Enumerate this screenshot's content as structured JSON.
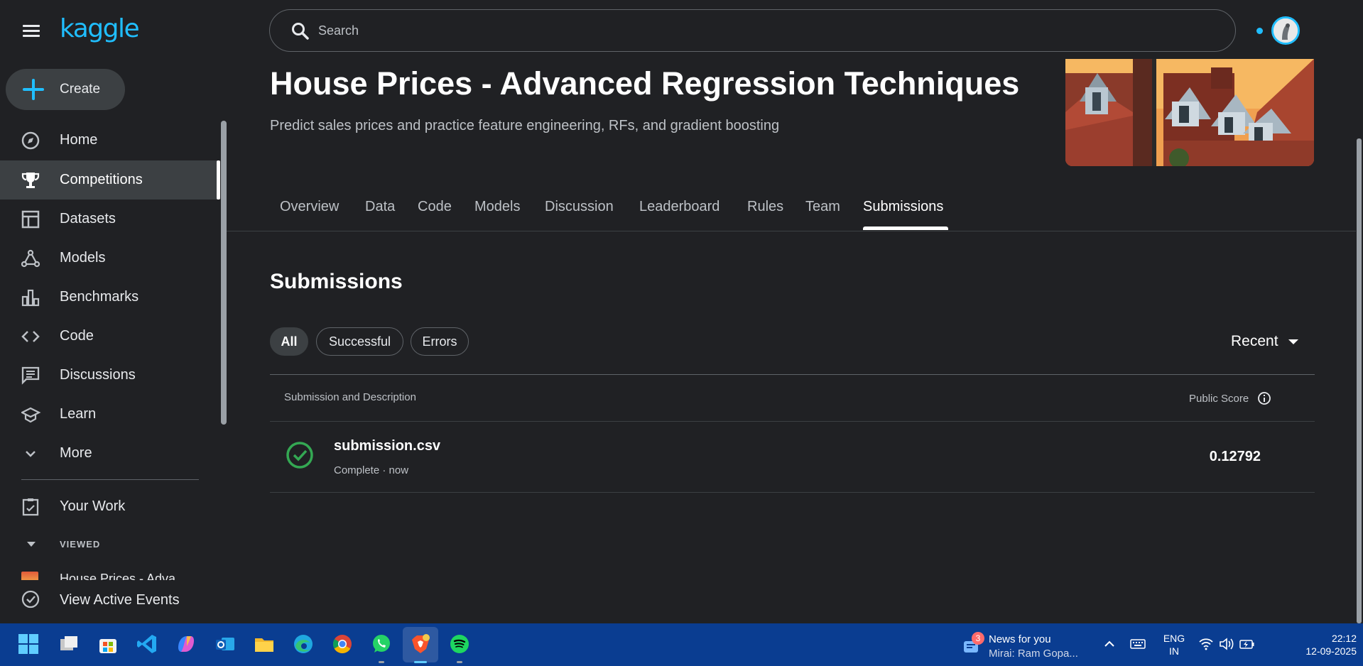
{
  "app": {
    "logo": "kaggle"
  },
  "sidebar": {
    "create_label": "Create",
    "items": [
      {
        "label": "Home",
        "icon": "compass-icon"
      },
      {
        "label": "Competitions",
        "icon": "trophy-icon",
        "active": true
      },
      {
        "label": "Datasets",
        "icon": "table-icon"
      },
      {
        "label": "Models",
        "icon": "models-icon"
      },
      {
        "label": "Benchmarks",
        "icon": "bar-chart-icon"
      },
      {
        "label": "Code",
        "icon": "code-icon"
      },
      {
        "label": "Discussions",
        "icon": "comment-icon"
      },
      {
        "label": "Learn",
        "icon": "school-icon"
      },
      {
        "label": "More",
        "icon": "chevron-down-icon"
      }
    ],
    "your_work": "Your Work",
    "viewed_heading": "VIEWED",
    "viewed_items": [
      {
        "label": "House Prices - Adva"
      }
    ],
    "active_events": "View Active Events"
  },
  "search": {
    "placeholder": "Search"
  },
  "competition": {
    "title": "House Prices - Advanced Regression Techniques",
    "subtitle": "Predict sales prices and practice feature engineering, RFs, and gradient boosting"
  },
  "tabs": [
    {
      "label": "Overview"
    },
    {
      "label": "Data"
    },
    {
      "label": "Code"
    },
    {
      "label": "Models"
    },
    {
      "label": "Discussion"
    },
    {
      "label": "Leaderboard"
    },
    {
      "label": "Rules"
    },
    {
      "label": "Team"
    },
    {
      "label": "Submissions",
      "active": true
    }
  ],
  "submissions": {
    "heading": "Submissions",
    "filters": [
      {
        "label": "All",
        "active": true
      },
      {
        "label": "Successful"
      },
      {
        "label": "Errors"
      }
    ],
    "sort_label": "Recent",
    "columns": {
      "left": "Submission and Description",
      "right": "Public Score"
    },
    "rows": [
      {
        "name": "submission.csv",
        "status": "Complete · now",
        "score": "0.12792"
      }
    ]
  },
  "taskbar": {
    "apps": [
      "windows-start-icon",
      "task-view-icon",
      "store-icon",
      "vscode-icon",
      "copilot-icon",
      "outlook-icon",
      "file-explorer-icon",
      "edge-icon",
      "chrome-icon",
      "whatsapp-icon",
      "brave-icon",
      "spotify-icon"
    ],
    "news": {
      "badge": "3",
      "title": "News for you",
      "subtitle": "Mirai: Ram Gopa..."
    },
    "language": {
      "line1": "ENG",
      "line2": "IN"
    },
    "time": "22:12",
    "date": "12-09-2025"
  },
  "colors": {
    "accent": "#20beff",
    "background": "#202124",
    "success": "#34a853",
    "taskbar": "#0a3d91"
  }
}
